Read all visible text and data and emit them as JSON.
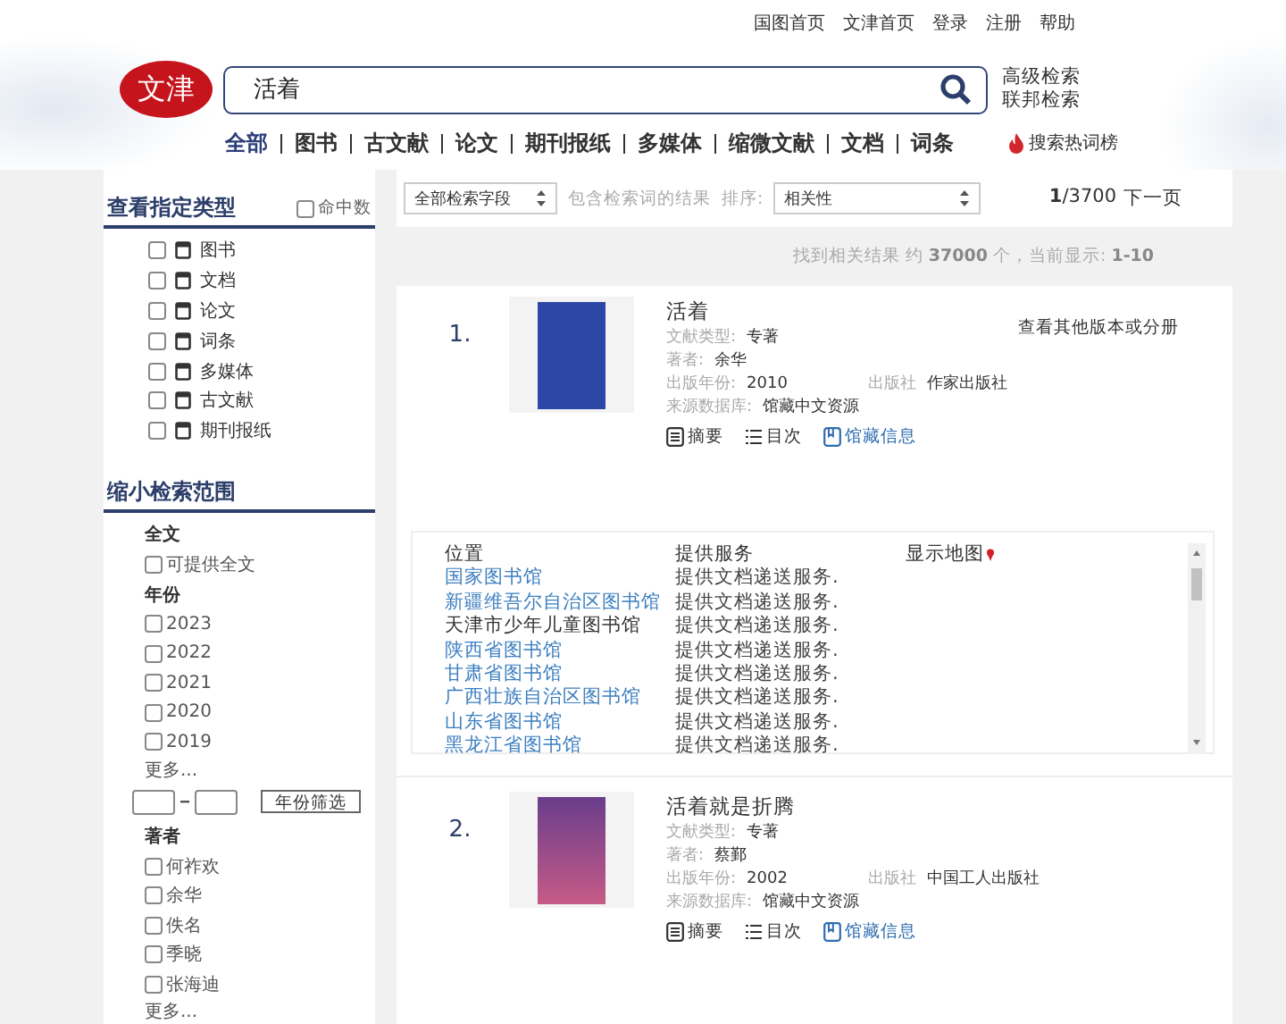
{
  "top_links": [
    "国图首页",
    "文津首页",
    "登录",
    "注册",
    "帮助"
  ],
  "logo": {
    "text": "文津"
  },
  "search": {
    "value": "活着"
  },
  "search_links": [
    "高级检索",
    "联邦检索"
  ],
  "categories": [
    {
      "label": "全部",
      "selected": true
    },
    {
      "label": "图书",
      "selected": false
    },
    {
      "label": "古文献",
      "selected": false
    },
    {
      "label": "论文",
      "selected": false
    },
    {
      "label": "期刊报纸",
      "selected": false
    },
    {
      "label": "多媒体",
      "selected": false
    },
    {
      "label": "缩微文献",
      "selected": false
    },
    {
      "label": "文档",
      "selected": false
    },
    {
      "label": "词条",
      "selected": false
    }
  ],
  "hot_search": "搜索热词榜",
  "type_panel": {
    "title": "查看指定类型",
    "hit_count": {
      "label": "命中数",
      "checked": false
    },
    "items": [
      {
        "label": "图书",
        "checked": false
      },
      {
        "label": "文档",
        "checked": false
      },
      {
        "label": "论文",
        "checked": false
      },
      {
        "label": "词条",
        "checked": false
      },
      {
        "label": "多媒体",
        "checked": false
      },
      {
        "label": "古文献",
        "checked": false
      },
      {
        "label": "期刊报纸",
        "checked": false
      }
    ]
  },
  "narrow_panel": {
    "title": "缩小检索范围",
    "groups": [
      {
        "heading": "全文",
        "options": [
          {
            "label": "可提供全文",
            "checked": false
          }
        ]
      },
      {
        "heading": "年份",
        "options": [
          {
            "label": "2023",
            "checked": false
          },
          {
            "label": "2022",
            "checked": false
          },
          {
            "label": "2021",
            "checked": false
          },
          {
            "label": "2020",
            "checked": false
          },
          {
            "label": "2019",
            "checked": false
          }
        ],
        "more": "更多...",
        "range_button": "年份筛选"
      },
      {
        "heading": "著者",
        "options": [
          {
            "label": "何祚欢",
            "checked": false
          },
          {
            "label": "余华",
            "checked": false
          },
          {
            "label": "佚名",
            "checked": false
          },
          {
            "label": "季晓",
            "checked": false
          },
          {
            "label": "张海迪",
            "checked": false
          }
        ],
        "more": "更多..."
      }
    ]
  },
  "toolbar": {
    "field_select": "全部检索字段",
    "within_results": "包含检索词的结果",
    "sort_label": "排序:",
    "sort_select": "相关性",
    "page": "**1**/3700",
    "next_page": "下一页"
  },
  "stats": "找到相关结果 约 **37000** 个，当前显示: **1-10**",
  "results": [
    {
      "number": "1.",
      "title": "活着",
      "other_editions": "查看其他版本或分册",
      "lines": [
        [
          {
            "label": "文献类型:",
            "value": "专著"
          }
        ],
        [
          {
            "label": "著者:",
            "value": "余华"
          }
        ],
        [
          {
            "label": "出版年份:",
            "value": "2010"
          },
          {
            "label": "出版社",
            "value": "作家出版社"
          }
        ],
        [
          {
            "label": "来源数据库:",
            "value": "馆藏中文资源"
          }
        ]
      ],
      "actions": [
        {
          "kind": "abstract",
          "label": "摘要"
        },
        {
          "kind": "toc",
          "label": "目次"
        },
        {
          "kind": "holdings",
          "label": "馆藏信息"
        }
      ],
      "holdings": {
        "columns": [
          "位置",
          "提供服务",
          "显示地图"
        ],
        "rows": [
          {
            "location": "国家图书馆",
            "link": true,
            "service": "提供文档递送服务."
          },
          {
            "location": "新疆维吾尔自治区图书馆",
            "link": true,
            "service": "提供文档递送服务."
          },
          {
            "location": "天津市少年儿童图书馆",
            "link": false,
            "service": "提供文档递送服务."
          },
          {
            "location": "陕西省图书馆",
            "link": true,
            "service": "提供文档递送服务."
          },
          {
            "location": "甘肃省图书馆",
            "link": true,
            "service": "提供文档递送服务."
          },
          {
            "location": "广西壮族自治区图书馆",
            "link": true,
            "service": "提供文档递送服务."
          },
          {
            "location": "山东省图书馆",
            "link": true,
            "service": "提供文档递送服务."
          },
          {
            "location": "黑龙江省图书馆",
            "link": true,
            "service": "提供文档递送服务."
          }
        ]
      }
    },
    {
      "number": "2.",
      "title": "活着就是折腾",
      "lines": [
        [
          {
            "label": "文献类型:",
            "value": "专著"
          }
        ],
        [
          {
            "label": "著者:",
            "value": "蔡鄞"
          }
        ],
        [
          {
            "label": "出版年份:",
            "value": "2002"
          },
          {
            "label": "出版社",
            "value": "中国工人出版社"
          }
        ],
        [
          {
            "label": "来源数据库:",
            "value": "馆藏中文资源"
          }
        ]
      ],
      "actions": [
        {
          "kind": "abstract",
          "label": "摘要"
        },
        {
          "kind": "toc",
          "label": "目次"
        },
        {
          "kind": "holdings",
          "label": "馆藏信息"
        }
      ]
    }
  ]
}
